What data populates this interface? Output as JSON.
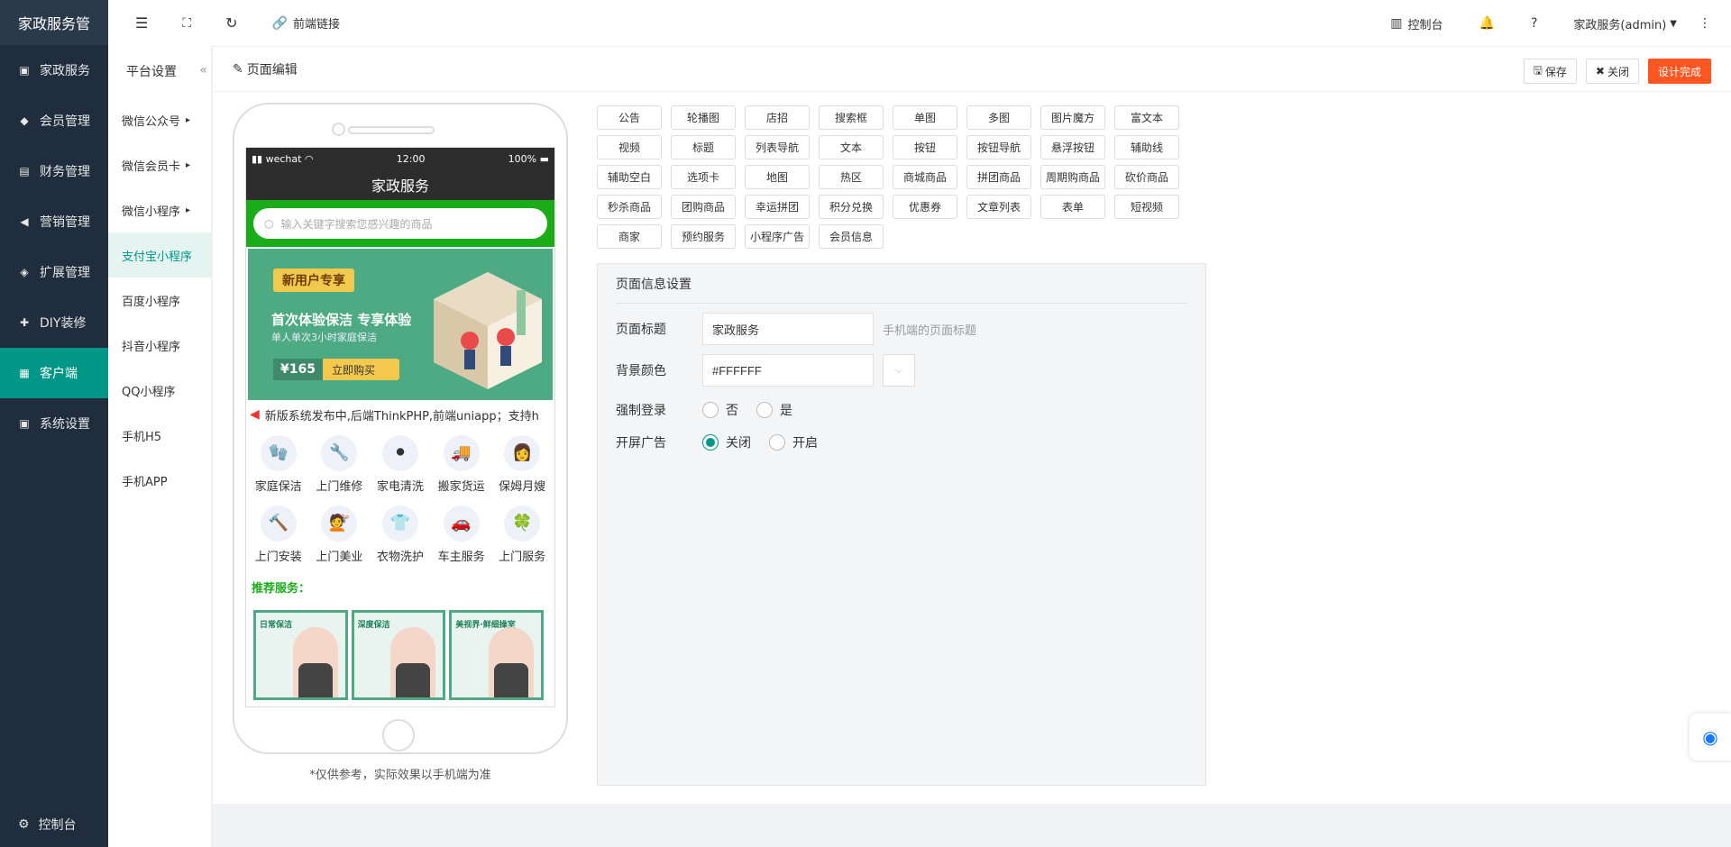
{
  "app": {
    "logo": "家政服务管",
    "footer": "控制台"
  },
  "nav": [
    {
      "label": "家政服务",
      "icon": "handbag-icon"
    },
    {
      "label": "会员管理",
      "icon": "gem-icon"
    },
    {
      "label": "财务管理",
      "icon": "money-icon"
    },
    {
      "label": "营销管理",
      "icon": "megaphone-icon"
    },
    {
      "label": "扩展管理",
      "icon": "box-icon"
    },
    {
      "label": "DIY装修",
      "icon": "puzzle-icon"
    },
    {
      "label": "客户端",
      "icon": "grid-icon"
    },
    {
      "label": "系统设置",
      "icon": "settings-icon"
    }
  ],
  "subnav": {
    "title": "平台设置",
    "items": [
      "微信公众号",
      "微信会员卡",
      "微信小程序",
      "支付宝小程序",
      "百度小程序",
      "抖音小程序",
      "QQ小程序",
      "手机H5",
      "手机APP"
    ]
  },
  "topbar": {
    "link": "前端链接",
    "console": "控制台",
    "user": "家政服务(admin)"
  },
  "page": {
    "title": "页面编辑",
    "save": "保存",
    "close": "关闭",
    "done": "设计完成"
  },
  "phone": {
    "carrier": "wechat",
    "time": "12:00",
    "battery": "100%",
    "title": "家政服务",
    "search_placeholder": "输入关键字搜索您感兴趣的商品",
    "banner": {
      "tag": "新用户专享",
      "headline": "首次体验保洁 专享体验",
      "sub": "单人单次3小时家庭保洁",
      "price": "¥165",
      "buy": "立即购买"
    },
    "notice": "新版系统发布中,后端ThinkPHP,前端uniapp；支持h",
    "services": [
      {
        "label": "家庭保洁",
        "icon": "🧤"
      },
      {
        "label": "上门维修",
        "icon": "🔧"
      },
      {
        "label": "家电清洗",
        "icon": "⚫"
      },
      {
        "label": "搬家货运",
        "icon": "🚚"
      },
      {
        "label": "保姆月嫂",
        "icon": "👩"
      },
      {
        "label": "上门安装",
        "icon": "🔨"
      },
      {
        "label": "上门美业",
        "icon": "💇"
      },
      {
        "label": "衣物洗护",
        "icon": "👕"
      },
      {
        "label": "车主服务",
        "icon": "🚗"
      },
      {
        "label": "上门服务",
        "icon": "🍀"
      }
    ],
    "recommend": "推荐服务：",
    "cards": [
      "日常保洁",
      "深度保洁",
      "美视界·鲜细操室"
    ]
  },
  "note": "*仅供参考，实际效果以手机端为准",
  "components": [
    "公告",
    "轮播图",
    "店招",
    "搜索框",
    "单图",
    "多图",
    "图片魔方",
    "富文本",
    "视频",
    "标题",
    "列表导航",
    "文本",
    "按钮",
    "按钮导航",
    "悬浮按钮",
    "辅助线",
    "辅助空白",
    "选项卡",
    "地图",
    "热区",
    "商城商品",
    "拼团商品",
    "周期购商品",
    "砍价商品",
    "秒杀商品",
    "团购商品",
    "幸运拼团",
    "积分兑换",
    "优惠券",
    "文章列表",
    "表单",
    "短视频",
    "商家",
    "预约服务",
    "小程序广告",
    "会员信息"
  ],
  "settings": {
    "title": "页面信息设置",
    "page_title_label": "页面标题",
    "page_title_value": "家政服务",
    "page_title_hint": "手机端的页面标题",
    "bg_label": "背景颜色",
    "bg_value": "#FFFFFF",
    "login_label": "强制登录",
    "login_no": "否",
    "login_yes": "是",
    "ad_label": "开屏广告",
    "ad_off": "关闭",
    "ad_on": "开启"
  },
  "colors": {
    "sidebar": "#1f2d3d",
    "accent": "#009688",
    "primary_button": "#ff5722",
    "phone_search": "#1aad19"
  }
}
